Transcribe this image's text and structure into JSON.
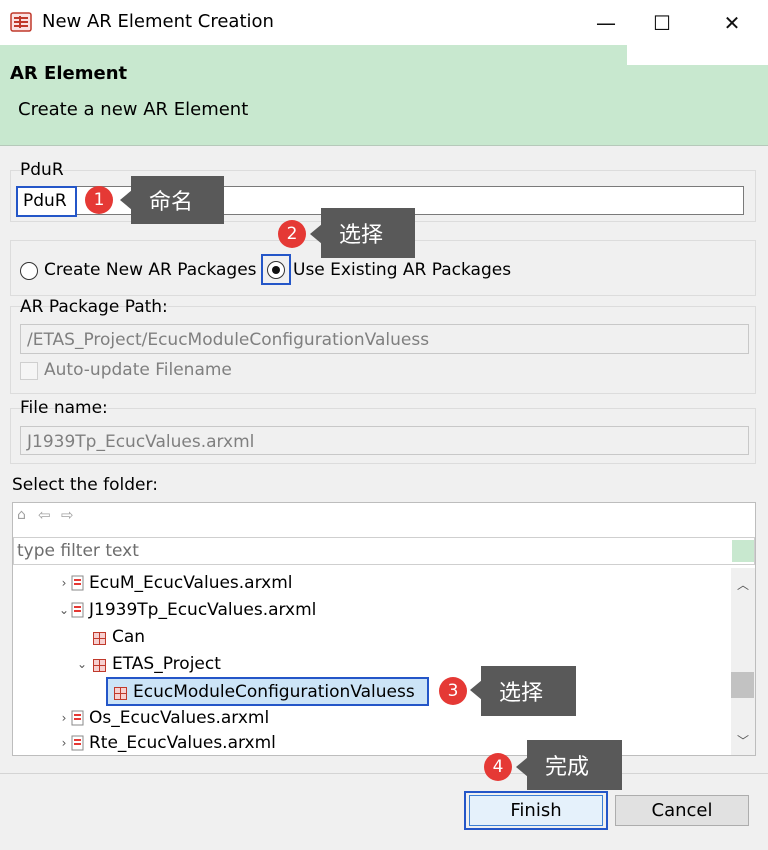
{
  "window": {
    "title": "New AR Element Creation",
    "minimize": "—",
    "maximize": "☐",
    "close": "✕"
  },
  "banner": {
    "title": "AR Element",
    "subtitle": "Create a new AR Element"
  },
  "name_group": {
    "label": "PduR",
    "value": "PduR"
  },
  "package_mode": {
    "option_new": "Create New AR Packages",
    "option_existing": "Use Existing AR Packages",
    "selected": "Use Existing AR Packages"
  },
  "package_path": {
    "label": "AR Package Path:",
    "value": "/ETAS_Project/EcucModuleConfigurationValuess",
    "auto_update_label": "Auto-update Filename"
  },
  "file_name": {
    "label": "File name:",
    "value": "J1939Tp_EcucValues.arxml"
  },
  "folder": {
    "label": "Select the folder:",
    "filter_placeholder": "type filter text",
    "tree": [
      {
        "label": "EcuM_EcucValues.arxml"
      },
      {
        "label": "J1939Tp_EcucValues.arxml"
      },
      {
        "label": "Can"
      },
      {
        "label": "ETAS_Project"
      },
      {
        "label": "EcucModuleConfigurationValuess"
      },
      {
        "label": "Os_EcucValues.arxml"
      },
      {
        "label": "Rte_EcucValues.arxml"
      }
    ]
  },
  "buttons": {
    "finish": "Finish",
    "cancel": "Cancel"
  },
  "callouts": [
    {
      "num": "1",
      "text": "命名"
    },
    {
      "num": "2",
      "text": "选择"
    },
    {
      "num": "3",
      "text": "选择"
    },
    {
      "num": "4",
      "text": "完成"
    }
  ],
  "colors": {
    "banner": "#c8e8cf",
    "highlight": "#2456c8",
    "callout_circle": "#e53935",
    "callout_box": "#595959",
    "selection": "#cce4f7"
  }
}
